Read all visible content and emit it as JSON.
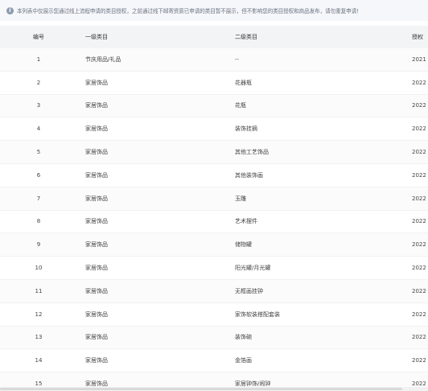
{
  "notice": {
    "icon": "info-icon",
    "text": "本列表中仅展示您通过线上流程申请的类目授权，之前通过线下邮寄资质已申请的类目暂不展示，但不影响您的类目授权和商品发布，请勿重复申请!"
  },
  "table": {
    "columns": [
      "编号",
      "一级类目",
      "二级类目",
      "授权"
    ],
    "rows": [
      {
        "no": "1",
        "cat1": "节庆用品/礼品",
        "cat2": "--",
        "date": "2021"
      },
      {
        "no": "2",
        "cat1": "家居饰品",
        "cat2": "花器瓶",
        "date": "2022"
      },
      {
        "no": "3",
        "cat1": "家居饰品",
        "cat2": "花瓶",
        "date": "2022"
      },
      {
        "no": "4",
        "cat1": "家居饰品",
        "cat2": "装饰挂摘",
        "date": "2022"
      },
      {
        "no": "5",
        "cat1": "家居饰品",
        "cat2": "其他工艺饰品",
        "date": "2022"
      },
      {
        "no": "6",
        "cat1": "家居饰品",
        "cat2": "其他装饰画",
        "date": "2022"
      },
      {
        "no": "7",
        "cat1": "家居饰品",
        "cat2": "玉雕",
        "date": "2022"
      },
      {
        "no": "8",
        "cat1": "家居饰品",
        "cat2": "艺术摆件",
        "date": "2022"
      },
      {
        "no": "9",
        "cat1": "家居饰品",
        "cat2": "储物罐",
        "date": "2022"
      },
      {
        "no": "10",
        "cat1": "家居饰品",
        "cat2": "阳光罐/月光罐",
        "date": "2022"
      },
      {
        "no": "11",
        "cat1": "家居饰品",
        "cat2": "无框画挂钟",
        "date": "2022"
      },
      {
        "no": "12",
        "cat1": "家居饰品",
        "cat2": "家饰软装搭配套装",
        "date": "2022"
      },
      {
        "no": "13",
        "cat1": "家居饰品",
        "cat2": "装饰碗",
        "date": "2022"
      },
      {
        "no": "14",
        "cat1": "家居饰品",
        "cat2": "金箔画",
        "date": "2022"
      },
      {
        "no": "15",
        "cat1": "家居饰品",
        "cat2": "家居钟饰/闹钟",
        "date": "2022"
      }
    ]
  }
}
